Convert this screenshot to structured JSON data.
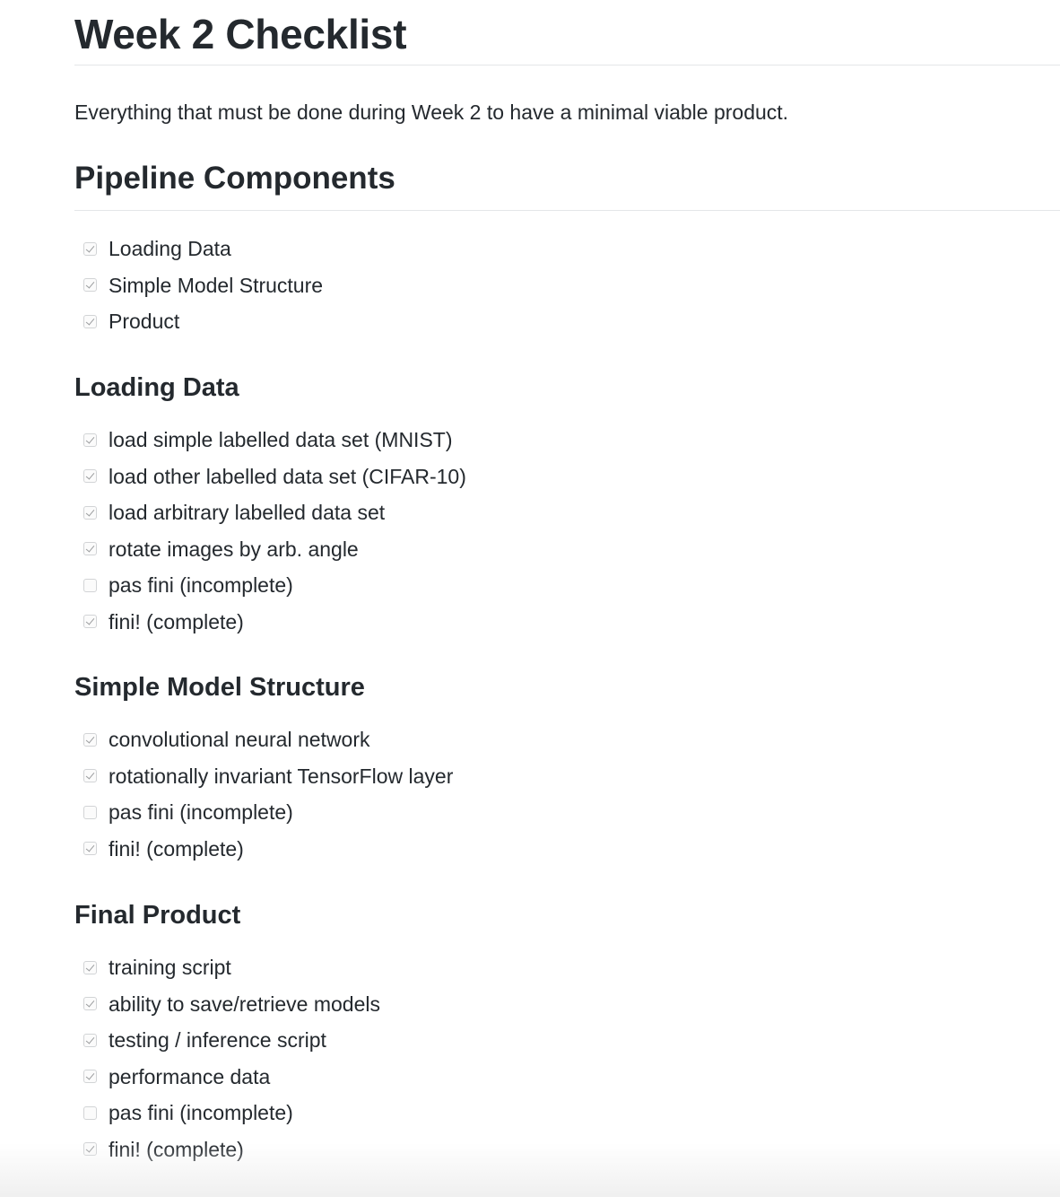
{
  "page": {
    "title": "Week 2 Checklist",
    "intro": "Everything that must be done during Week 2 to have a minimal viable product."
  },
  "sections": [
    {
      "heading": "Pipeline Components",
      "items": [
        {
          "label": "Loading Data",
          "checked": true
        },
        {
          "label": "Simple Model Structure",
          "checked": true
        },
        {
          "label": "Product",
          "checked": true
        }
      ]
    },
    {
      "heading": "Loading Data",
      "items": [
        {
          "label": "load simple labelled data set (MNIST)",
          "checked": true
        },
        {
          "label": "load other labelled data set (CIFAR-10)",
          "checked": true
        },
        {
          "label": "load arbitrary labelled data set",
          "checked": true
        },
        {
          "label": "rotate images by arb. angle",
          "checked": true
        },
        {
          "label": "pas fini (incomplete)",
          "checked": false
        },
        {
          "label": "fini! (complete)",
          "checked": true
        }
      ]
    },
    {
      "heading": "Simple Model Structure",
      "items": [
        {
          "label": "convolutional neural network",
          "checked": true
        },
        {
          "label": "rotationally invariant TensorFlow layer",
          "checked": true
        },
        {
          "label": "pas fini (incomplete)",
          "checked": false
        },
        {
          "label": "fini! (complete)",
          "checked": true
        }
      ]
    },
    {
      "heading": "Final Product",
      "items": [
        {
          "label": "training script",
          "checked": true
        },
        {
          "label": "ability to save/retrieve models",
          "checked": true
        },
        {
          "label": "testing / inference script",
          "checked": true
        },
        {
          "label": "performance data",
          "checked": true
        },
        {
          "label": "pas fini (incomplete)",
          "checked": false
        },
        {
          "label": "fini! (complete)",
          "checked": true
        }
      ]
    }
  ]
}
